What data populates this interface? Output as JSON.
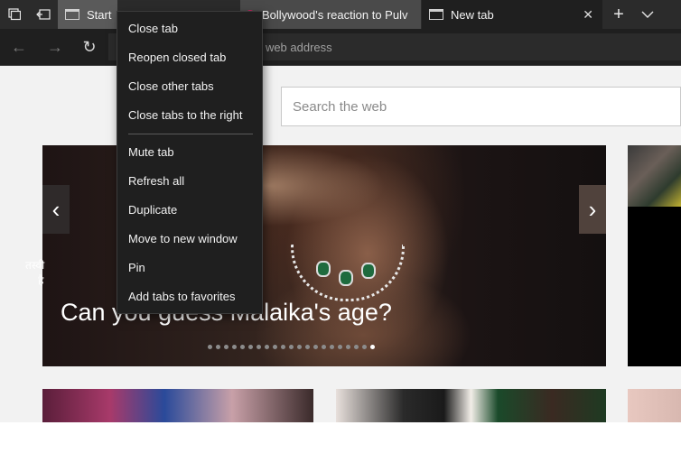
{
  "tabbar": {
    "tabs": [
      {
        "label": "Start"
      },
      {
        "label": "Bollywood's reaction to Pulv"
      },
      {
        "label": "New tab"
      }
    ],
    "close_glyph": "✕",
    "new_tab_glyph": "+",
    "tab_list_glyph": "⌄"
  },
  "navbar": {
    "address_placeholder": "r web address",
    "back_glyph": "←",
    "forward_glyph": "→",
    "refresh_glyph": "↻"
  },
  "search": {
    "placeholder": "Search the web"
  },
  "hero": {
    "caption": "Can you guess Malaika's age?",
    "prev_glyph": "‹",
    "next_glyph": "›",
    "dot_count": 21,
    "active_dot": 20
  },
  "side_card": {
    "text_line1": "तस्वी",
    "text_line2": "है"
  },
  "context_menu": {
    "items": [
      "Close tab",
      "Reopen closed tab",
      "Close other tabs",
      "Close tabs to the right",
      "Mute tab",
      "Refresh all",
      "Duplicate",
      "Move to new window",
      "Pin",
      "Add tabs to favorites"
    ]
  },
  "colors": {
    "tabbar": "#2b2b2b",
    "menu": "#1f1f1f",
    "page": "#f2f2f2"
  }
}
